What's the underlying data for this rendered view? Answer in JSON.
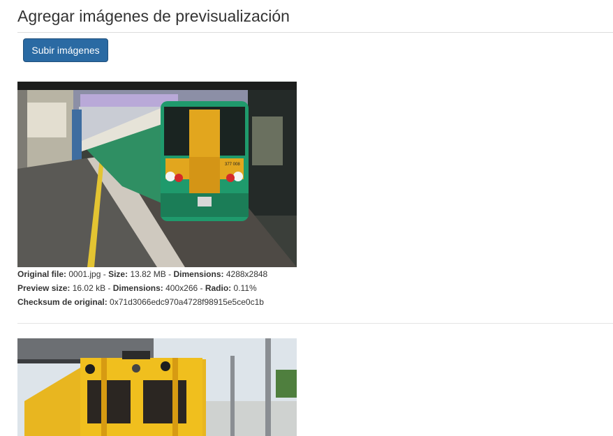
{
  "header": {
    "title": "Agregar imágenes de previsualización"
  },
  "toolbar": {
    "upload_label": "Subir imágenes"
  },
  "images": [
    {
      "original_file_label": "Original file:",
      "original_file": "0001.jpg",
      "size_label": "Size:",
      "size": "13.82 MB",
      "dimensions_label": "Dimensions:",
      "dimensions": "4288x2848",
      "preview_size_label": "Preview size:",
      "preview_size": "16.02 kB",
      "preview_dimensions_label": "Dimensions:",
      "preview_dimensions": "400x266",
      "ratio_label": "Radio:",
      "ratio": "0.11%",
      "checksum_label": "Checksum de original:",
      "checksum": "0x71d3066edc970a4728f98915e5ce0c1b",
      "train_number": "377 008"
    },
    {}
  ]
}
